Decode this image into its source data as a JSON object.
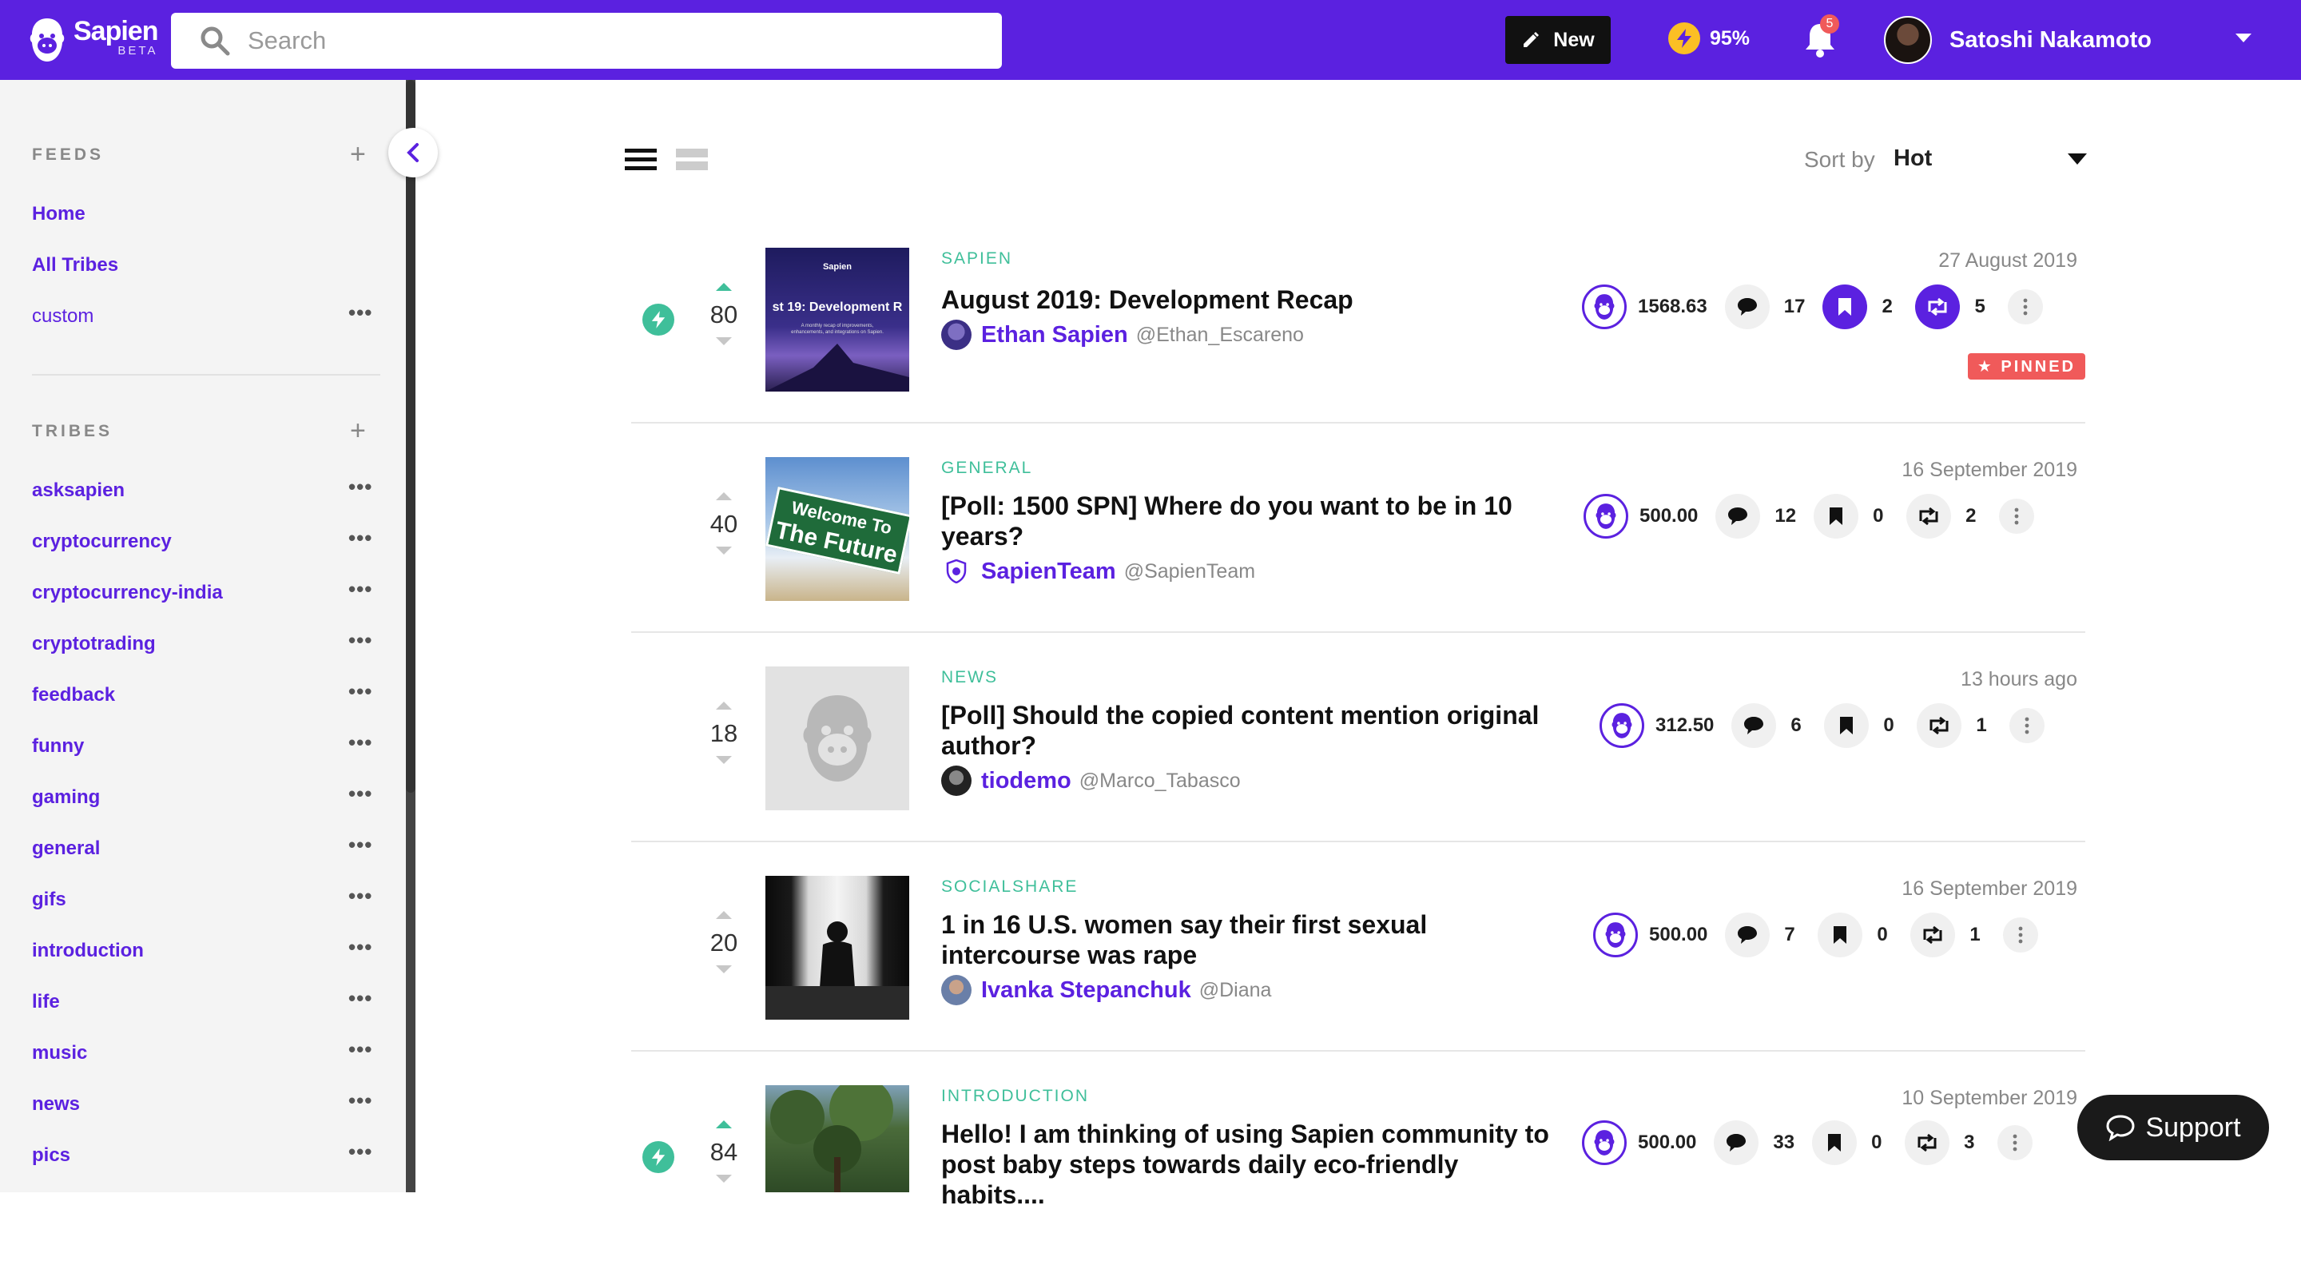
{
  "header": {
    "logo_name": "Sapien",
    "logo_beta": "BETA",
    "search_placeholder": "Search",
    "new_label": "New",
    "energy": "95%",
    "notifications": "5",
    "user_name": "Satoshi Nakamoto"
  },
  "sidebar": {
    "feeds_title": "FEEDS",
    "feeds": [
      {
        "label": "Home"
      },
      {
        "label": "All Tribes"
      },
      {
        "label": "custom"
      }
    ],
    "tribes_title": "TRIBES",
    "tribes": [
      {
        "label": "asksapien"
      },
      {
        "label": "cryptocurrency"
      },
      {
        "label": "cryptocurrency-india"
      },
      {
        "label": "cryptotrading"
      },
      {
        "label": "feedback"
      },
      {
        "label": "funny"
      },
      {
        "label": "gaming"
      },
      {
        "label": "general"
      },
      {
        "label": "gifs"
      },
      {
        "label": "introduction"
      },
      {
        "label": "life"
      },
      {
        "label": "music"
      },
      {
        "label": "news"
      },
      {
        "label": "pics"
      }
    ]
  },
  "sort": {
    "label": "Sort by",
    "value": "Hot"
  },
  "posts": [
    {
      "tribe": "SAPIEN",
      "title": "August 2019: Development Recap",
      "author": "Ethan Sapien",
      "handle": "@Ethan_Escareno",
      "votes": "80",
      "date": "27 August 2019",
      "spn": "1568.63",
      "comments": "17",
      "bookmarks": "2",
      "reposts": "5",
      "pinned": "PINNED",
      "thumb_title": "st 19: Development R",
      "thumb_brand": "Sapien",
      "thumb_sub": "A monthly recap of improvements, enhancements, and integrations on Sapien."
    },
    {
      "tribe": "GENERAL",
      "title": "[Poll: 1500 SPN] Where do you want to be in 10 years?",
      "author": "SapienTeam",
      "handle": "@SapienTeam",
      "votes": "40",
      "date": "16 September 2019",
      "spn": "500.00",
      "comments": "12",
      "bookmarks": "0",
      "reposts": "2",
      "thumb_sign_1": "Welcome To",
      "thumb_sign_2": "The Future"
    },
    {
      "tribe": "NEWS",
      "title": "[Poll] Should the copied content mention original author?",
      "author": "tiodemo",
      "handle": "@Marco_Tabasco",
      "votes": "18",
      "date": "13 hours ago",
      "spn": "312.50",
      "comments": "6",
      "bookmarks": "0",
      "reposts": "1"
    },
    {
      "tribe": "SOCIALSHARE",
      "title": "1 in 16 U.S. women say their first sexual intercourse was rape",
      "author": "Ivanka Stepanchuk",
      "handle": "@Diana",
      "votes": "20",
      "date": "16 September 2019",
      "spn": "500.00",
      "comments": "7",
      "bookmarks": "0",
      "reposts": "1"
    },
    {
      "tribe": "INTRODUCTION",
      "title": "Hello! I am thinking of using Sapien community to post baby steps towards daily eco-friendly habits....",
      "votes": "84",
      "date": "10 September 2019",
      "spn": "500.00",
      "comments": "33",
      "bookmarks": "0",
      "reposts": "3"
    }
  ],
  "support_label": "Support",
  "colors": {
    "brand": "#5b21e0",
    "accent": "#3fbf9a",
    "pinned": "#f05a5a"
  }
}
